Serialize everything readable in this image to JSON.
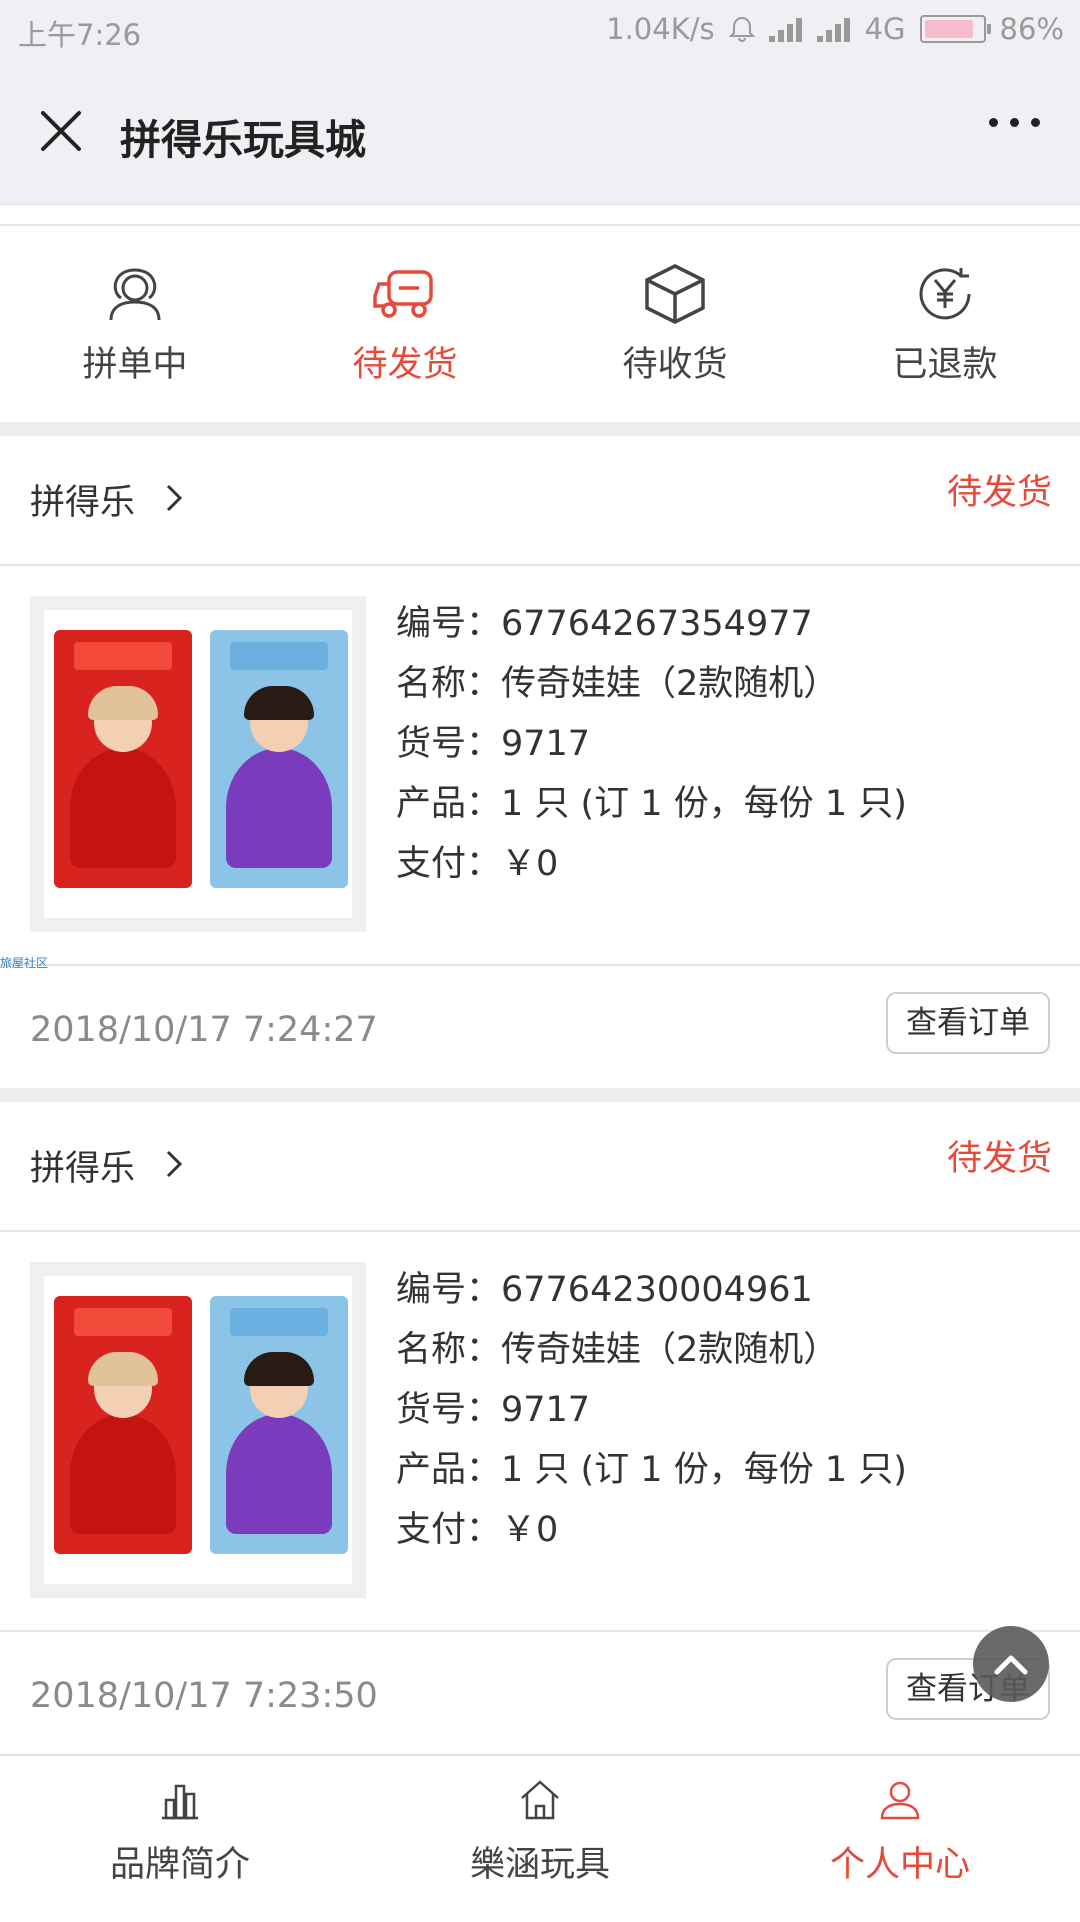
{
  "status_bar": {
    "time": "上午7:26",
    "net_speed": "1.04K/s",
    "network": "4G",
    "battery": "86%",
    "battery_level": 0.86
  },
  "header": {
    "title": "拼得乐玩具城",
    "close_icon": "close-icon",
    "more_icon": "more-dots-icon"
  },
  "tabs": [
    {
      "label": "拼单中",
      "icon": "group-person-icon",
      "active": false
    },
    {
      "label": "待发货",
      "icon": "truck-icon",
      "active": true
    },
    {
      "label": "待收货",
      "icon": "box-icon",
      "active": false
    },
    {
      "label": "已退款",
      "icon": "refund-yen-icon",
      "active": false
    }
  ],
  "orders": [
    {
      "shop": "拼得乐",
      "status": "待发货",
      "id_line": "编号：67764267354977",
      "name_line": "名称：传奇娃娃（2款随机）",
      "sku_line": "货号：9717",
      "product_line": "产品：1 只 (订 1 份，每份 1 只)",
      "pay_line": "支付：￥0",
      "date": "2018/10/17 7:24:27",
      "button": "查看订单"
    },
    {
      "shop": "拼得乐",
      "status": "待发货",
      "id_line": "编号：67764230004961",
      "name_line": "名称：传奇娃娃（2款随机）",
      "sku_line": "货号：9717",
      "product_line": "产品：1 只 (订 1 份，每份 1 只)",
      "pay_line": "支付：￥0",
      "date": "2018/10/17 7:23:50",
      "button": "查看订单"
    }
  ],
  "watermark": "旅屋社区",
  "bottom_nav": [
    {
      "label": "品牌简介",
      "icon": "bar-chart-icon",
      "active": false
    },
    {
      "label": "樂涵玩具",
      "icon": "home-icon",
      "active": false
    },
    {
      "label": "个人中心",
      "icon": "user-icon",
      "active": true
    }
  ],
  "colors": {
    "accent": "#e64a3b",
    "background": "#efeff4"
  }
}
